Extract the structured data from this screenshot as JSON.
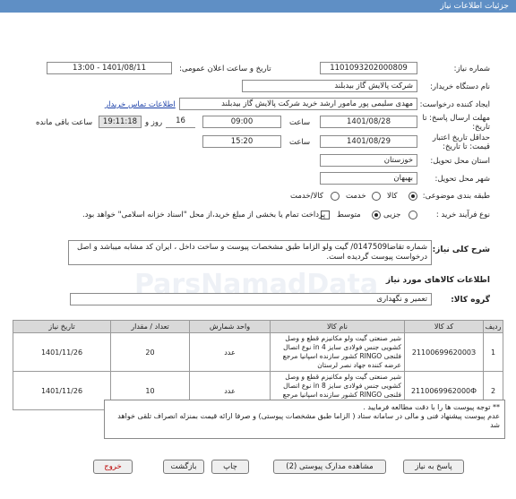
{
  "header": {
    "title": "جزئیات اطلاعات نیاز"
  },
  "fields": {
    "need_number_label": "شماره نیاز:",
    "need_number": "1101093202000809",
    "announce_label": "تاریخ و ساعت اعلان عمومی:",
    "announce_value": "1401/08/11 - 13:00",
    "buyer_label": "نام دستگاه خریدار:",
    "buyer_value": "شرکت پالایش گاز بیدبلند",
    "creator_label": "ایجاد کننده درخواست:",
    "creator_value": "مهدی سلیمی پور مامور ارشد خرید شرکت پالایش گاز بیدبلند",
    "contact_link": "اطلاعات تماس خریدار",
    "deadline_label": "مهلت ارسال پاسخ: تا تاریخ:",
    "deadline_date": "1401/08/28",
    "time_label": "ساعت",
    "deadline_time": "09:00",
    "days_value": "16",
    "days_label": "روز و",
    "remaining_time": "19:11:18",
    "remaining_label": "ساعت باقی مانده",
    "min_validity_label": "حداقل تاریخ اعتبار قیمت: تا تاریخ:",
    "validity_date": "1401/08/29",
    "validity_time": "15:20",
    "province_label": "استان محل تحویل:",
    "province_value": "خوزستان",
    "city_label": "شهر محل تحویل:",
    "city_value": "بهبهان",
    "category_label": "طبقه بندی موضوعی:",
    "cat_goods": "کالا",
    "cat_service": "خدمت",
    "cat_goods_service": "کالا/خدمت",
    "process_label": "نوع فرآیند خرید :",
    "proc_partial": "جزیی",
    "proc_medium": "متوسط",
    "payment_note": "پرداخت تمام یا بخشی از مبلغ خرید،از محل \"اسناد خزانه اسلامی\" خواهد بود."
  },
  "general_description": {
    "label": "شرح کلی نیاز:",
    "text": "شماره تقاضا0147509/ گیت ولو  الزاما طبق مشخصات پیوست و ساخت داخل ، ایران کد مشابه میباشد و اصل درخواست پیوست گردیده است."
  },
  "goods_info": {
    "title": "اطلاعات کالاهای مورد نیاز",
    "group_label": "گروه کالا:",
    "group_value": "تعمیر و نگهداری"
  },
  "table": {
    "headers": [
      "ردیف",
      "کد کالا",
      "نام کالا",
      "واحد شمارش",
      "تعداد / مقدار",
      "تاریخ نیاز"
    ],
    "rows": [
      {
        "row": "1",
        "code": "2110069962000З",
        "name": "شیر صنعتی گیت ولو مکانیزم قطع و وصل کشویی جنس فولادی سایز 4 in نوع اتصال فلنجی RINGO کشور سازنده اسپانیا مرجع عرضه کننده جهاد نصر لرستان",
        "unit": "عدد",
        "qty": "20",
        "date": "1401/11/26"
      },
      {
        "row": "2",
        "code": "2110069962000Ф",
        "name": "شیر صنعتی گیت ولو مکانیزم قطع و وصل کشویی جنس فولادی سایز 8 in نوع اتصال فلنجی RINGO کشور سازنده اسپانیا مرجع عرضه کننده جهاد نصر لرستان",
        "unit": "عدد",
        "qty": "10",
        "date": "1401/11/26"
      }
    ]
  },
  "notes": {
    "line1": "** توجه پیوست ها  را با دقت مطالعه فرمایید .",
    "line2": "عدم پیوست پیشنهاد فنی و مالی در سامانه ستاد ( الزاما طبق مشخصات پیوستی)  و صرفا ارائه قیمت بمنزله انصراف تلقی خواهد شد"
  },
  "buttons": {
    "reply": "پاسخ به نیاز",
    "attachments": "مشاهده مدارک پیوستی (2)",
    "print": "چاپ",
    "back": "بازگشت",
    "exit": "خروج"
  },
  "watermark": {
    "text": "ParsNamadData"
  }
}
